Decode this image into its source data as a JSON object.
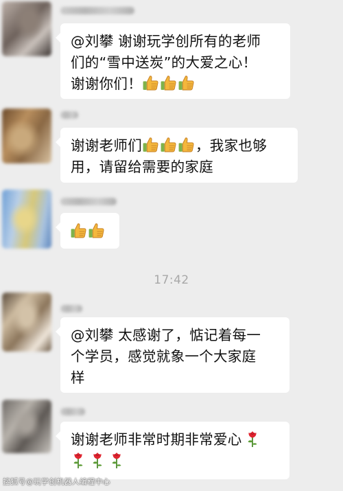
{
  "chat": {
    "messages": [
      {
        "lines": [
          "@刘攀 谢谢玩学创所有的老师",
          "们的“雪中送炭”的大爱之心！",
          "谢谢你们！"
        ],
        "thumbs_after_last_line": 3
      },
      {
        "lines": [
          "谢谢老师们",
          "，我家也够",
          "用，请留给需要的家庭"
        ],
        "thumbs_after_first_segment": 3
      },
      {
        "thumbs_only": 2
      },
      {
        "lines": [
          "@刘攀 太感谢了，惦记着每一",
          "个学员，感觉就象一个大家庭",
          "样"
        ]
      },
      {
        "lines": [
          "谢谢老师非常时期非常爱心"
        ],
        "roses_after_first_line": 1,
        "roses_second_line": 3
      }
    ],
    "timestamp": "17:42"
  },
  "icons": {
    "thumbs": "thumbs-up-emoji",
    "rose": "rose-emoji"
  },
  "watermark": "搜狐号@玩学创机器人编程中心"
}
